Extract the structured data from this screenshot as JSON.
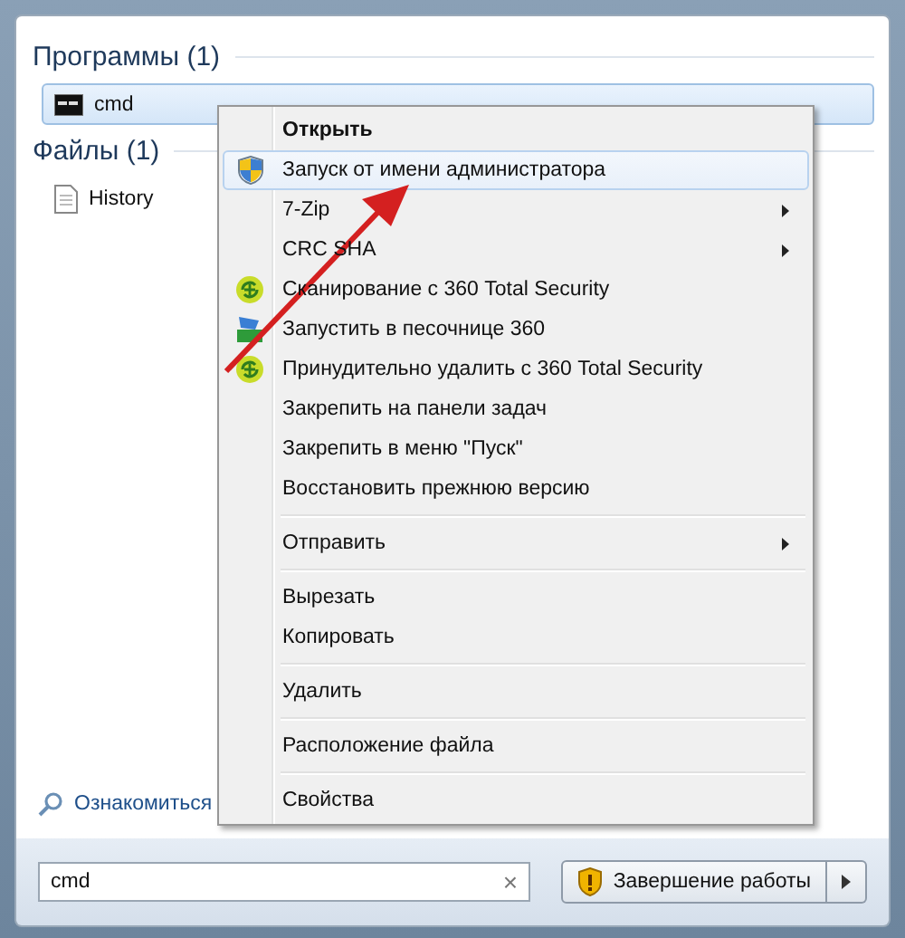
{
  "start_menu": {
    "sections": [
      {
        "heading": "Программы (1)",
        "items": [
          {
            "label": "cmd",
            "selected": true,
            "kind": "console"
          }
        ]
      },
      {
        "heading": "Файлы (1)",
        "items": [
          {
            "label": "History",
            "selected": false,
            "kind": "document"
          }
        ]
      }
    ],
    "see_more": "Ознакомиться",
    "search": {
      "value": "cmd",
      "clear": "×"
    },
    "shutdown": {
      "label": "Завершение работы"
    }
  },
  "context_menu": {
    "groups": [
      [
        {
          "label": "Открыть",
          "default": true,
          "selected": false,
          "submenu": false
        },
        {
          "label": "Запуск от имени администратора",
          "selected": true,
          "submenu": false,
          "kind": "elevated"
        },
        {
          "label": "7-Zip",
          "selected": false,
          "submenu": true
        },
        {
          "label": "CRC SHA",
          "selected": false,
          "submenu": true
        },
        {
          "label": "Сканирование с 360 Total Security",
          "selected": false,
          "submenu": false,
          "kind": "scan"
        },
        {
          "label": "Запустить в песочнице 360",
          "selected": false,
          "submenu": false,
          "kind": "sandbox"
        },
        {
          "label": "Принудительно удалить с  360 Total Security",
          "selected": false,
          "submenu": false,
          "kind": "scan"
        },
        {
          "label": "Закрепить на панели задач",
          "selected": false,
          "submenu": false
        },
        {
          "label": "Закрепить в меню \"Пуск\"",
          "selected": false,
          "submenu": false
        },
        {
          "label": "Восстановить прежнюю версию",
          "selected": false,
          "submenu": false
        }
      ],
      [
        {
          "label": "Отправить",
          "selected": false,
          "submenu": true
        }
      ],
      [
        {
          "label": "Вырезать",
          "selected": false,
          "submenu": false
        },
        {
          "label": "Копировать",
          "selected": false,
          "submenu": false
        }
      ],
      [
        {
          "label": "Удалить",
          "selected": false,
          "submenu": false
        }
      ],
      [
        {
          "label": "Расположение файла",
          "selected": false,
          "submenu": false
        }
      ],
      [
        {
          "label": "Свойства",
          "selected": false,
          "submenu": false
        }
      ]
    ]
  }
}
